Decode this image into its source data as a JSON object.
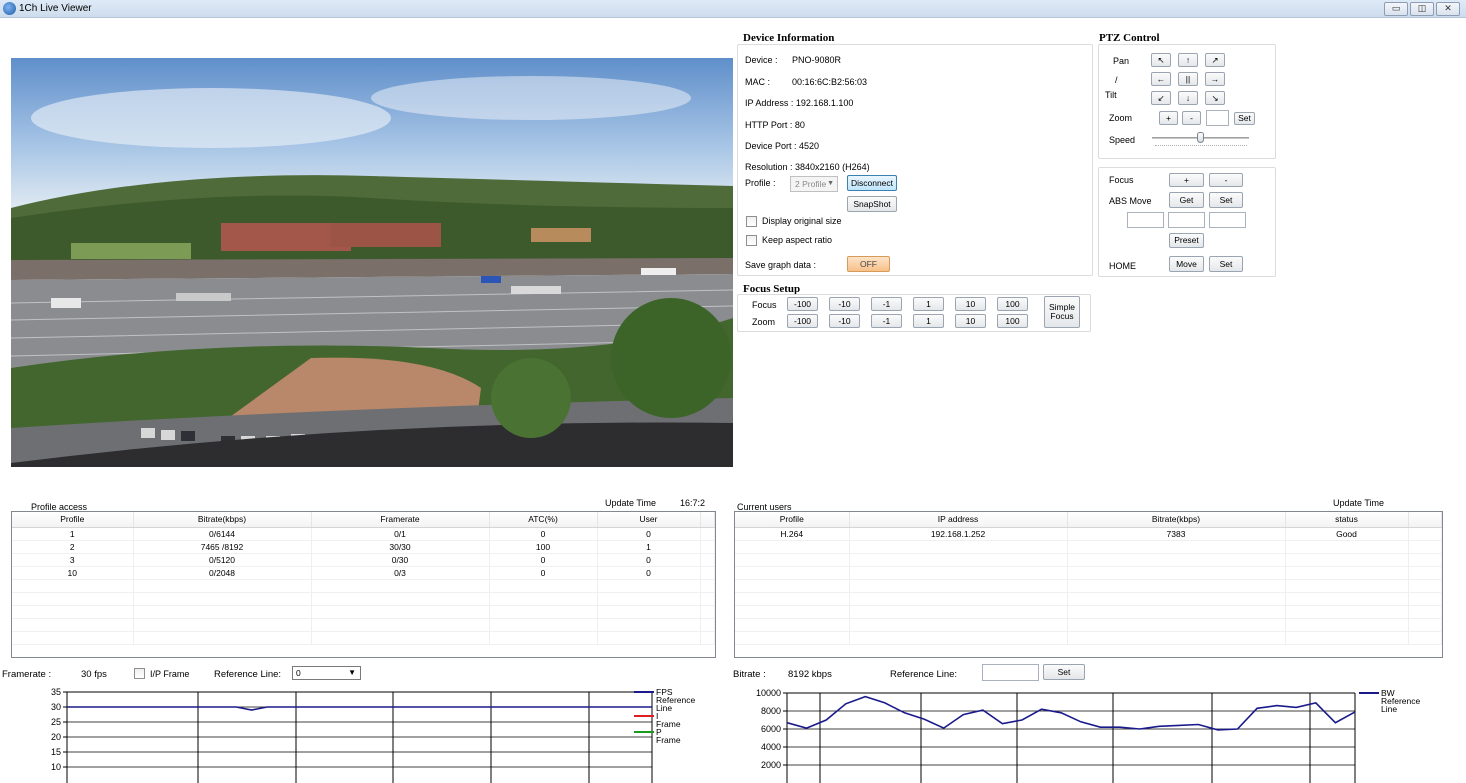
{
  "window": {
    "title": "1Ch Live Viewer",
    "buttons": [
      "▭",
      "◫",
      "✕"
    ]
  },
  "device_info": {
    "title": "Device Information",
    "device_label": "Device :",
    "device_value": "PNO-9080R",
    "mac_label": "MAC :",
    "mac_value": "00:16:6C:B2:56:03",
    "ip": "IP Address : 192.168.1.100",
    "http_port": "HTTP Port : 80",
    "device_port": "Device Port : 4520",
    "resolution": "Resolution : 3840x2160 (H264)",
    "profile_label": "Profile :",
    "profile_value": "2 Profile",
    "disconnect": "Disconnect",
    "snapshot": "SnapShot",
    "display_original": "Display original size",
    "keep_aspect": "Keep aspect ratio",
    "save_graph_label": "Save graph data :",
    "save_graph_value": "OFF"
  },
  "focus_setup": {
    "title": "Focus Setup",
    "focus_label": "Focus",
    "zoom_label": "Zoom",
    "steps": [
      "-100",
      "-10",
      "-1",
      "1",
      "10",
      "100"
    ],
    "simple_focus": "Simple Focus"
  },
  "ptz": {
    "title": "PTZ Control",
    "pan": "Pan",
    "slash": "/",
    "tilt": "Tilt",
    "arrows": [
      "↖",
      "↑",
      "↗",
      "←",
      "||",
      "→",
      "↙",
      "↓",
      "↘"
    ],
    "zoom": "Zoom",
    "zoom_in": "+",
    "zoom_out": "-",
    "zoom_set": "Set",
    "speed": "Speed",
    "focus": "Focus",
    "focus_plus": "+",
    "focus_minus": "-",
    "abs_move": "ABS Move",
    "get": "Get",
    "set": "Set",
    "preset": "Preset",
    "home": "HOME",
    "move": "Move",
    "home_set": "Set"
  },
  "profile_access": {
    "title": "Profile access",
    "update_label": "Update Time",
    "update_value": "16:7:2",
    "columns": [
      "Profile",
      "Bitrate(kbps)",
      "Framerate",
      "ATC(%)",
      "User"
    ],
    "rows": [
      [
        "1",
        "0/6144",
        "0/1",
        "0",
        "0"
      ],
      [
        "2",
        "7465 /8192",
        "30/30",
        "100",
        "1"
      ],
      [
        "3",
        "0/5120",
        "0/30",
        "0",
        "0"
      ],
      [
        "10",
        "0/2048",
        "0/3",
        "0",
        "0"
      ]
    ]
  },
  "current_users": {
    "title": "Current users",
    "update_label": "Update Time",
    "columns": [
      "Profile",
      "IP address",
      "Bitrate(kbps)",
      "status"
    ],
    "rows": [
      [
        "H.264",
        "192.168.1.252",
        "7383",
        "Good"
      ]
    ]
  },
  "framerate_bar": {
    "label": "Framerate :",
    "value": "30  fps",
    "ip_frame": "I/P Frame",
    "ref_label": "Reference Line:",
    "ref_value": "0"
  },
  "bitrate_bar": {
    "label": "Bitrate :",
    "value": "8192  kbps",
    "ref_label": "Reference Line:",
    "set": "Set"
  },
  "colors": {
    "series": "#1a1a8c",
    "reference": "#1a1a8c",
    "i_frame": "#e02020",
    "p_frame": "#1a9a1a"
  },
  "chart_data": [
    {
      "type": "line",
      "legend": [
        "FPS",
        "Reference Line",
        "I Frame",
        "P Frame"
      ],
      "y_ticks": [
        "35",
        "30",
        "25",
        "20",
        "15",
        "10"
      ],
      "ylim": [
        8,
        35
      ],
      "series": [
        {
          "name": "FPS",
          "values": [
            30,
            30,
            30,
            30,
            30,
            30,
            30,
            30,
            30,
            30,
            30,
            30,
            29,
            30,
            30,
            30,
            30,
            30,
            30,
            30,
            30,
            30,
            30,
            30,
            30,
            30,
            30,
            30,
            30,
            30,
            30,
            30,
            30,
            30,
            30,
            30,
            30,
            30,
            30
          ]
        }
      ]
    },
    {
      "type": "line",
      "legend": [
        "BW",
        "Reference Line"
      ],
      "y_ticks": [
        "10000",
        "8000",
        "6000",
        "4000",
        "2000"
      ],
      "ylim": [
        1000,
        10000
      ],
      "series": [
        {
          "name": "BW",
          "values": [
            6700,
            6100,
            7000,
            8800,
            9600,
            8900,
            7800,
            7100,
            6100,
            7600,
            8100,
            6600,
            7000,
            8200,
            7800,
            6800,
            6200,
            6200,
            6000,
            6300,
            6400,
            6500,
            5900,
            6000,
            8300,
            8600,
            8400,
            8900,
            6700,
            7900
          ]
        }
      ]
    }
  ]
}
